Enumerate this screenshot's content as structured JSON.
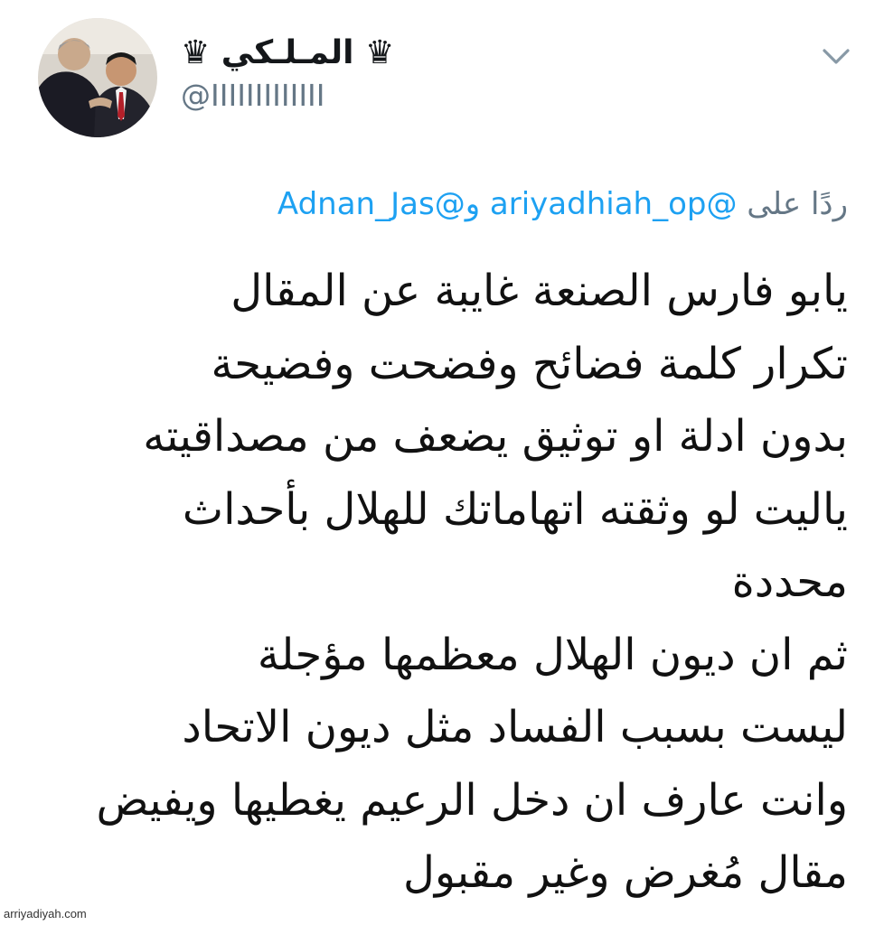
{
  "tweet": {
    "display_name": "♛ المـلـكي ♛",
    "username": "@IIIIIIIIIIIII",
    "reply": {
      "prefix": "ردًا على",
      "mention_1": "@ariyadhiah_op",
      "conjunction": "و",
      "mention_2": "@Adnan_Jas"
    },
    "body_lines": [
      "يابو فارس الصنعة غايبة عن المقال",
      "تكرار كلمة فضائح وفضحت وفضيحة",
      "بدون ادلة او توثيق يضعف من مصداقيته",
      "ياليت لو وثقته اتهاماتك للهلال بأحداث",
      "محددة",
      "ثم ان ديون الهلال معظمها مؤجلة",
      "ليست بسبب الفساد مثل ديون الاتحاد",
      "وانت عارف ان دخل الرعيم يغطيها ويفيض",
      "مقال مُغرض وغير مقبول"
    ]
  },
  "icons": {
    "menu": "chevron-down-icon",
    "avatar": "profile-photo"
  },
  "colors": {
    "text": "#14171a",
    "secondary": "#657786",
    "link": "#1da1f2"
  },
  "watermark": "arriyadiyah.com"
}
